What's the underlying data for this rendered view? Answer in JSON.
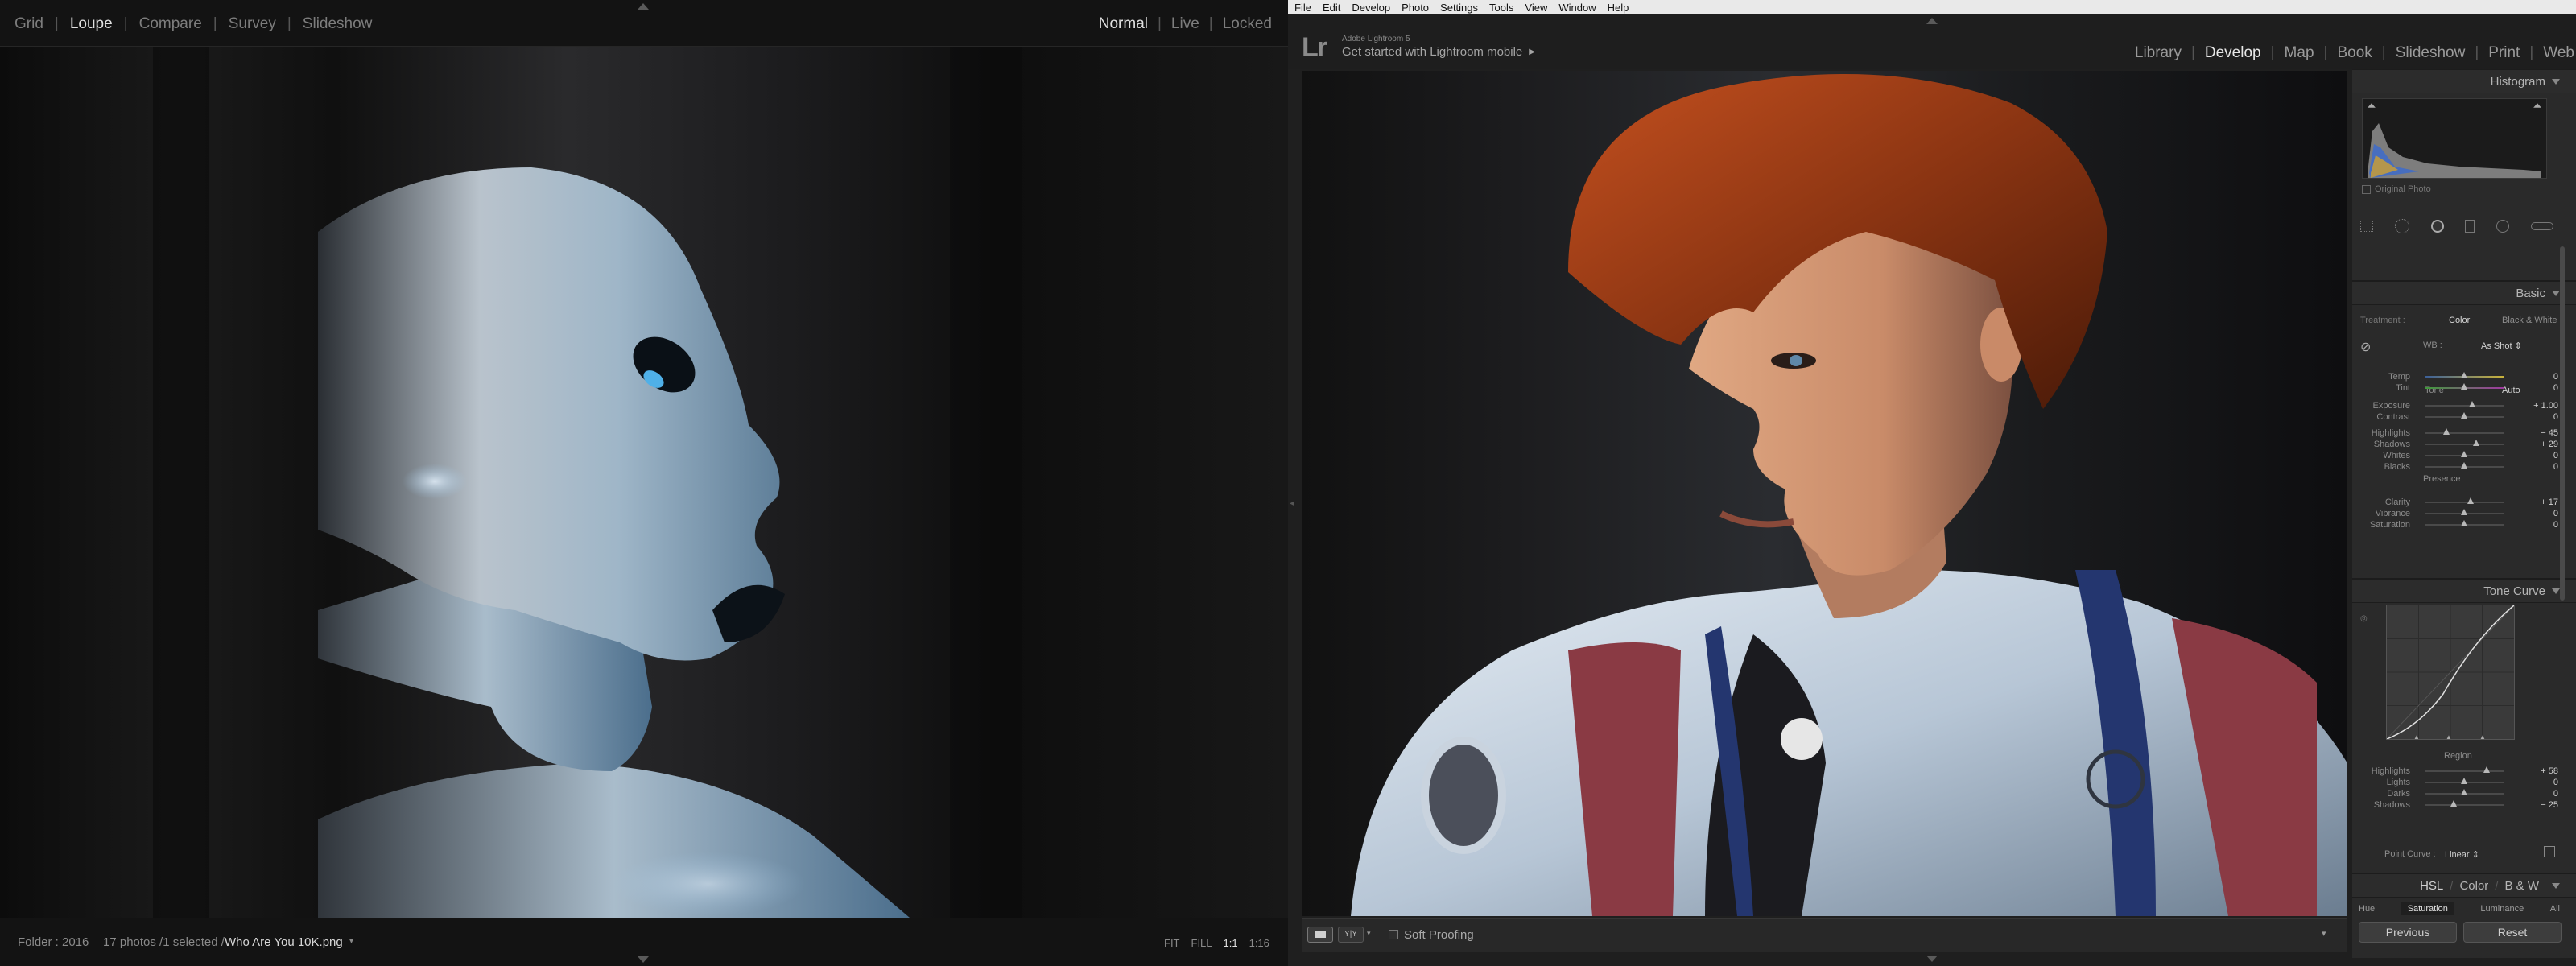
{
  "secondary_window": {
    "nav": [
      "Grid",
      "Loupe",
      "Compare",
      "Survey",
      "Slideshow"
    ],
    "active_nav": "Loupe",
    "modes": [
      "Normal",
      "Live",
      "Locked"
    ],
    "active_mode": "Normal",
    "status": {
      "folder": "Folder : 2016",
      "count": "17 photos /1 selected /",
      "filename": "Who Are You 10K.png"
    },
    "zoom": [
      "FIT",
      "FILL",
      "1:1",
      "1:16"
    ]
  },
  "menubar": [
    "File",
    "Edit",
    "Develop",
    "Photo",
    "Settings",
    "Tools",
    "View",
    "Window",
    "Help"
  ],
  "identity": {
    "logo": "Lr",
    "app_name": "Adobe Lightroom 5",
    "tagline": "Get started with Lightroom mobile"
  },
  "modules": [
    "Library",
    "Develop",
    "Map",
    "Book",
    "Slideshow",
    "Print",
    "Web"
  ],
  "active_module": "Develop",
  "toolbar": {
    "soft_proofing": "Soft Proofing"
  },
  "panels": {
    "histogram": {
      "title": "Histogram",
      "original_photo": "Original Photo"
    },
    "basic": {
      "title": "Basic",
      "treatment_label": "Treatment :",
      "treatment_options": [
        "Color",
        "Black & White"
      ],
      "wb_label": "WB :",
      "wb_value": "As Shot",
      "tone_label": "Tone",
      "auto_label": "Auto",
      "presence_label": "Presence",
      "sliders": [
        {
          "label": "Temp",
          "value": "0",
          "pos": 0.5
        },
        {
          "label": "Tint",
          "value": "0",
          "pos": 0.5
        },
        {
          "label": "Exposure",
          "value": "+ 1.00",
          "pos": 0.6
        },
        {
          "label": "Contrast",
          "value": "0",
          "pos": 0.5
        },
        {
          "label": "Highlights",
          "value": "− 45",
          "pos": 0.28
        },
        {
          "label": "Shadows",
          "value": "+ 29",
          "pos": 0.65
        },
        {
          "label": "Whites",
          "value": "0",
          "pos": 0.5
        },
        {
          "label": "Blacks",
          "value": "0",
          "pos": 0.5
        },
        {
          "label": "Clarity",
          "value": "+ 17",
          "pos": 0.58
        },
        {
          "label": "Vibrance",
          "value": "0",
          "pos": 0.5
        },
        {
          "label": "Saturation",
          "value": "0",
          "pos": 0.5
        }
      ]
    },
    "tone_curve": {
      "title": "Tone Curve",
      "region_label": "Region",
      "sliders": [
        {
          "label": "Highlights",
          "value": "+ 58",
          "pos": 0.79
        },
        {
          "label": "Lights",
          "value": "0",
          "pos": 0.5
        },
        {
          "label": "Darks",
          "value": "0",
          "pos": 0.5
        },
        {
          "label": "Shadows",
          "value": "− 25",
          "pos": 0.37
        }
      ],
      "point_curve_label": "Point Curve :",
      "point_curve_value": "Linear"
    },
    "hsl": {
      "tabs_header": [
        "HSL",
        "Color",
        "B & W"
      ],
      "tabs": [
        "Hue",
        "Saturation",
        "Luminance",
        "All"
      ],
      "active_tab": "Saturation"
    }
  },
  "buttons": {
    "previous": "Previous",
    "reset": "Reset"
  }
}
